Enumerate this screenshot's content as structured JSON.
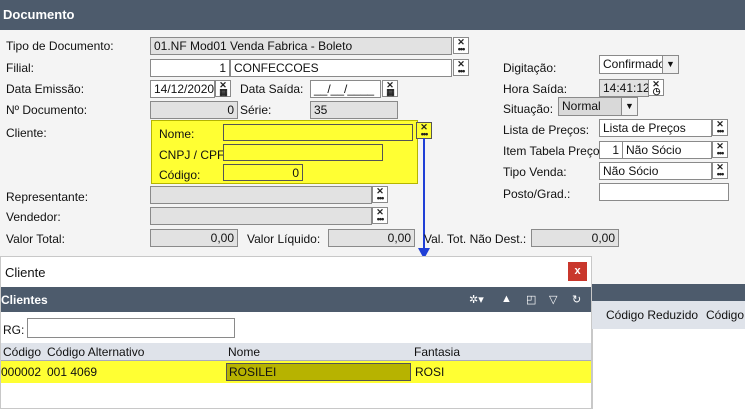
{
  "header": {
    "title": "Documento"
  },
  "form": {
    "tipo_documento": {
      "label": "Tipo de Documento:",
      "value": "01.NF Mod01 Venda Fabrica - Boleto"
    },
    "filial": {
      "label": "Filial:",
      "code": "1",
      "name": "CONFECCOES"
    },
    "data_emissao": {
      "label": "Data Emissão:",
      "value": "14/12/2020"
    },
    "data_saida": {
      "label": "Data Saída:",
      "value": "__/__/____"
    },
    "n_documento": {
      "label": "Nº Documento:",
      "value": "0"
    },
    "serie": {
      "label": "Série:",
      "value": "35"
    },
    "cliente": {
      "label": "Cliente:"
    },
    "nome": {
      "label": "Nome:",
      "value": ""
    },
    "cnpj": {
      "label": "CNPJ / CPF:",
      "value": ""
    },
    "codigo": {
      "label": "Código:",
      "value": "0"
    },
    "representante": {
      "label": "Representante:",
      "value": ""
    },
    "vendedor": {
      "label": "Vendedor:",
      "value": ""
    },
    "valor_total": {
      "label": "Valor Total:",
      "value": "0,00"
    },
    "valor_liquido": {
      "label": "Valor Líquido:",
      "value": "0,00"
    },
    "val_tot_nao_dest": {
      "label": "Val. Tot. Não Dest.:",
      "value": "0,00"
    },
    "digitacao": {
      "label": "Digitação:",
      "value": "Confirmado"
    },
    "hora_saida": {
      "label": "Hora Saída:",
      "value": "14:41:12"
    },
    "situacao": {
      "label": "Situação:",
      "value": "Normal"
    },
    "lista_precos": {
      "label": "Lista de Preços:",
      "value": "Lista de Preços"
    },
    "item_tabela_preco": {
      "label": "Item Tabela Preço:",
      "code": "1",
      "name": "Não Sócio"
    },
    "tipo_venda": {
      "label": "Tipo Venda:",
      "value": "Não Sócio"
    },
    "posto_grad": {
      "label": "Posto/Grad.:",
      "value": ""
    }
  },
  "dialog": {
    "title": "Cliente",
    "close_label": "x",
    "grid_title": "Clientes",
    "rg_label": "RG:",
    "rg_value": "",
    "columns": [
      "Código",
      "Código Alternativo",
      "Nome",
      "Fantasia"
    ],
    "rows": [
      {
        "codigo": "000002",
        "alternativo": "001 4069",
        "nome": "ROSILEI",
        "fantasia": "ROSI"
      }
    ]
  },
  "background_grid": {
    "columns": [
      "Código Reduzido",
      "Código"
    ]
  },
  "colors": {
    "header": "#4d5b6c",
    "highlight": "#ffff33",
    "arrow": "#1f3fd6",
    "close": "#c9372c"
  }
}
